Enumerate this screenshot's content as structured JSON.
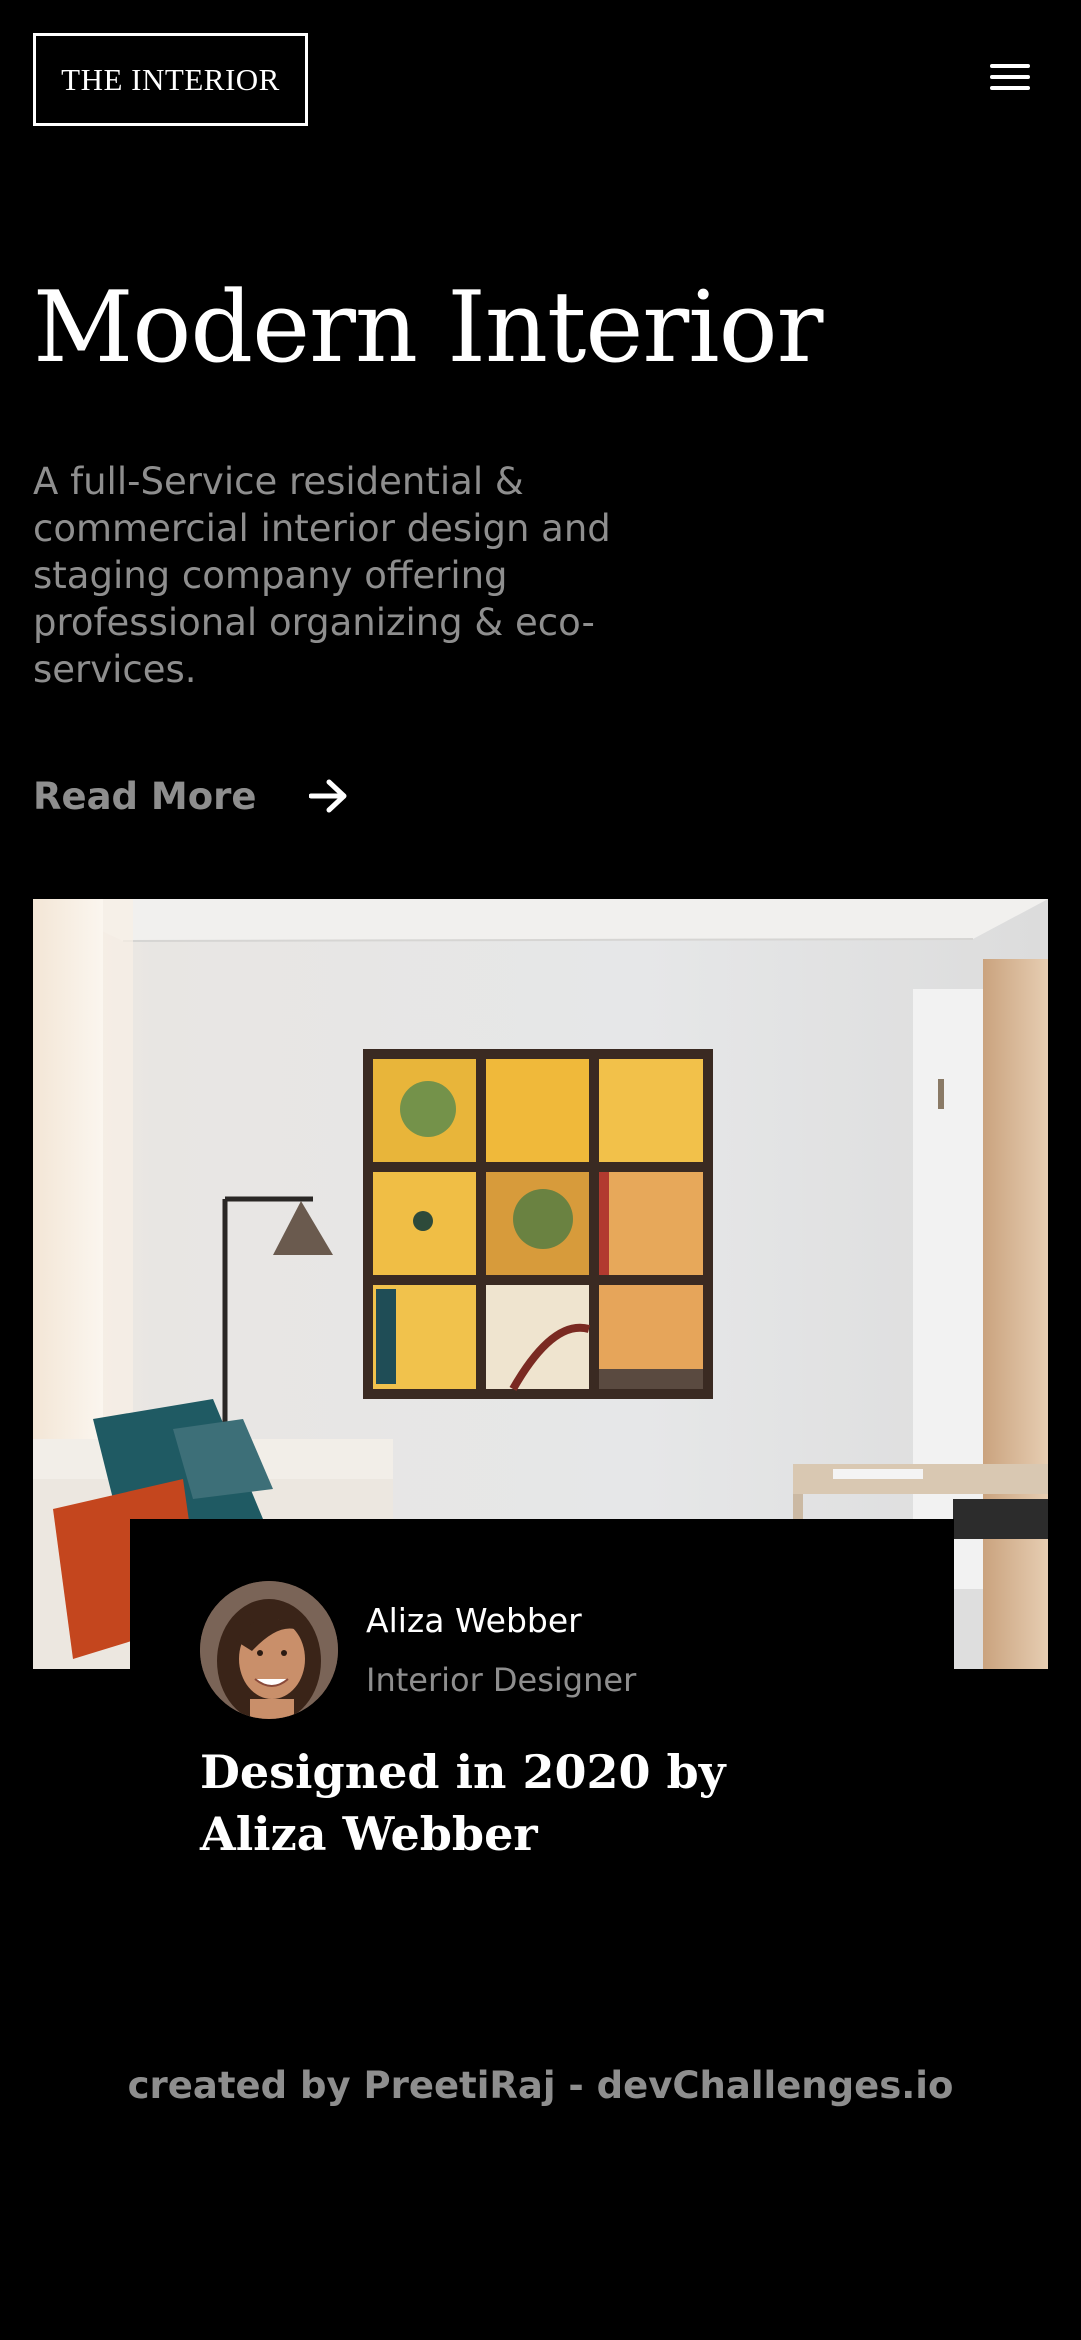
{
  "header": {
    "logo_text": "THE INTERIOR",
    "menu_icon": "hamburger-menu-icon"
  },
  "hero": {
    "title": "Modern Interior",
    "description": "A full-Service residential & commercial interior design and staging company offering professional organizing & eco-services.",
    "read_more_label": "Read More",
    "read_more_icon": "arrow-right-icon"
  },
  "designer_card": {
    "name": "Aliza Webber",
    "role": "Interior Designer",
    "headline": "Designed in 2020 by Aliza Webber"
  },
  "footer": {
    "credit": "created by PreetiRaj - devChallenges.io"
  },
  "colors": {
    "background": "#000000",
    "text_primary": "#ffffff",
    "text_muted": "#8e8e8e"
  }
}
